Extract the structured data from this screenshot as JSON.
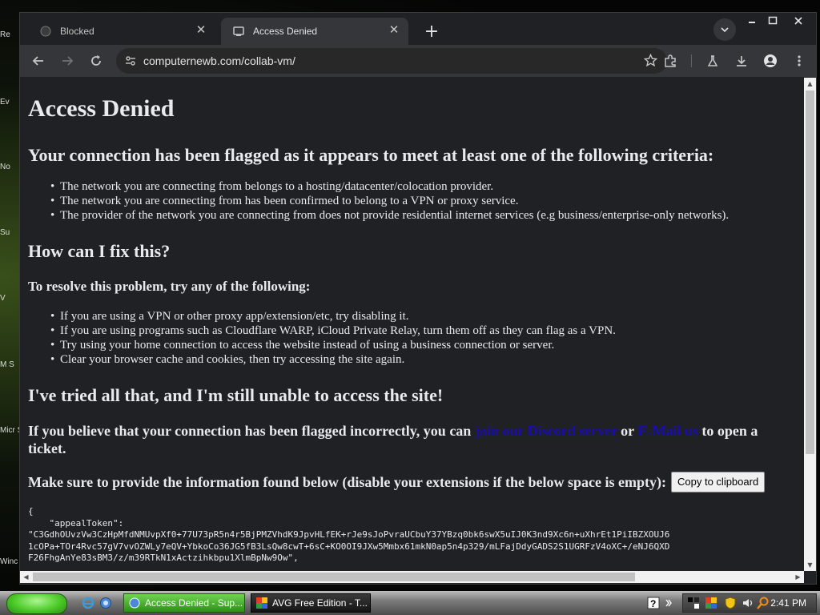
{
  "desktop": {
    "icon_labels": [
      "Re",
      "Ev",
      "No",
      "Su",
      "V",
      "M S",
      "Micr Stu",
      "Winc"
    ]
  },
  "browser": {
    "tabs": [
      {
        "title": "Blocked",
        "icon": "blocked-favicon",
        "active": false
      },
      {
        "title": "Access Denied",
        "icon": "page-favicon",
        "active": true
      }
    ],
    "url": "computernewb.com/collab-vm/"
  },
  "page": {
    "title": "Access Denied",
    "criteria_heading": "Your connection has been flagged as it appears to meet at least one of the following criteria:",
    "criteria": [
      "The network you are connecting from belongs to a hosting/datacenter/colocation provider.",
      "The network you are connecting from has been confirmed to belong to a VPN or proxy service.",
      "The provider of the network you are connecting from does not provide residential internet services (e.g business/enterprise-only networks)."
    ],
    "fix_heading": "How can I fix this?",
    "resolve_heading": "To resolve this problem, try any of the following:",
    "resolve_steps": [
      "If you are using a VPN or other proxy app/extension/etc, try disabling it.",
      "If you are using programs such as Cloudflare WARP, iCloud Private Relay, turn them off as they can flag as a VPN.",
      "Try using your home connection to access the website instead of using a business connection or server.",
      "Clear your browser cache and cookies, then try accessing the site again."
    ],
    "tried_heading": "I've tried all that, and I'm still unable to access the site!",
    "believe_pre": "If you believe that your connection has been flagged incorrectly, you can ",
    "discord_link": "join our Discord server",
    "believe_mid": " or ",
    "email_link": "E-Mail us",
    "believe_post": " to open a ticket.",
    "info_text": "Make sure to provide the information found below (disable your extensions if the below space is empty):",
    "copy_button": "Copy to clipboard",
    "token_lines": [
      "{",
      "    \"appealToken\":",
      "\"C3GdhOUvzVw3CzHpMfdNMUvpXf0+77U73pR5n4r5BjPMZVhdK9JpvHLfEK+rJe9sJoPvraUCbuY37YBzq0bk6swX5uIJ0K3nd9Xc6n+uXhrEt1PiIBZXOUJ6",
      "1cOPa+TOr4Rvc57gV7vvOZWLy7eQV+YbkoCo36JG5fB3LsQw8cwT+6sC+KO0OI9JXw5Mmbx61mkN0ap5n4p329/mLFajDdyGADS2S1UGRFzV4oXC+/eNJ6QXD",
      "F26FhgAnYe83sBM3/z/m39RTkN1xActzihkbpu1XlmBpNw9Ow\","
    ]
  },
  "taskbar": {
    "items": [
      {
        "label": "Access Denied - Sup...",
        "icon": "browser-icon"
      },
      {
        "label": "AVG Free Edition - T...",
        "icon": "avg-icon"
      }
    ],
    "clock": "2:41 PM"
  }
}
